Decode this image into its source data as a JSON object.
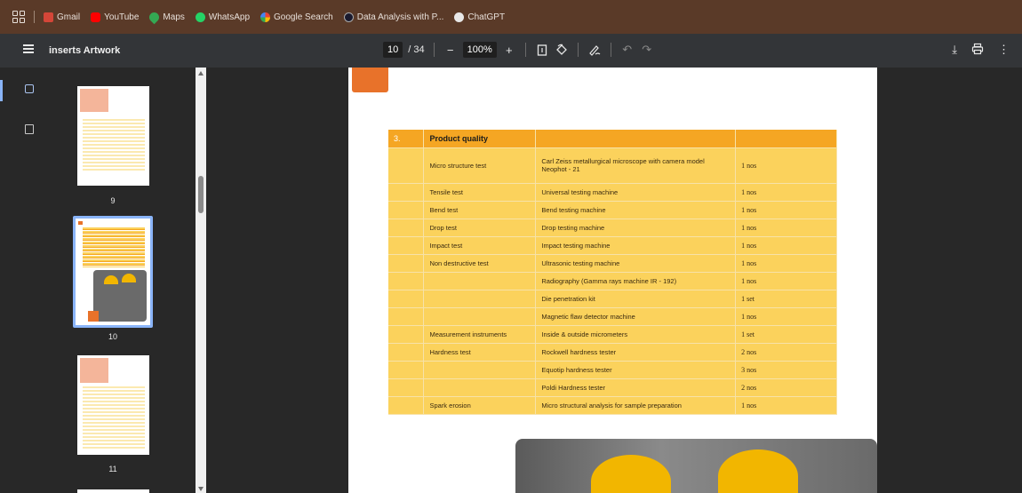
{
  "bookmarks": [
    {
      "label": "Gmail",
      "icon": "gmail-icon",
      "color": "#d44638"
    },
    {
      "label": "YouTube",
      "icon": "youtube-icon",
      "color": "#ff0000"
    },
    {
      "label": "Maps",
      "icon": "maps-icon",
      "color": "#34a853"
    },
    {
      "label": "WhatsApp",
      "icon": "whatsapp-icon",
      "color": "#25d366"
    },
    {
      "label": "Google Search",
      "icon": "google-icon",
      "color": "#4285f4"
    },
    {
      "label": "Data Analysis with P...",
      "icon": "data-analysis-icon",
      "color": "#1a1a2e"
    },
    {
      "label": "ChatGPT",
      "icon": "chatgpt-icon",
      "color": "#e8e8e8"
    }
  ],
  "toolbar": {
    "title": "inserts Artwork",
    "page_current": "10",
    "page_total": "/ 34",
    "zoom": "100%",
    "zoom_out": "−",
    "zoom_in": "+"
  },
  "thumbnails": [
    {
      "label": "9"
    },
    {
      "label": "10"
    },
    {
      "label": "11"
    }
  ],
  "table": {
    "header": {
      "no": "3.",
      "title": "Product quality"
    },
    "rows": [
      {
        "test": "Micro structure test",
        "equipment": "Carl Zeiss metallurgical microscope with camera model Neophot - 21",
        "qty": "1 nos",
        "tall": true
      },
      {
        "test": "Tensile test",
        "equipment": "Universal testing machine",
        "qty": "1 nos"
      },
      {
        "test": "Bend test",
        "equipment": "Bend testing machine",
        "qty": "1 nos"
      },
      {
        "test": "Drop test",
        "equipment": "Drop testing machine",
        "qty": "1 nos"
      },
      {
        "test": "Impact test",
        "equipment": "Impact testing machine",
        "qty": "1 nos"
      },
      {
        "test": "Non destructive test",
        "equipment": "Ultrasonic testing machine",
        "qty": "1 nos"
      },
      {
        "test": "",
        "equipment": "Radiography (Gamma rays machine IR - 192)",
        "qty": "1 nos"
      },
      {
        "test": "",
        "equipment": "Die penetration kit",
        "qty": "1 set"
      },
      {
        "test": "",
        "equipment": "Magnetic flaw detector machine",
        "qty": "1 nos"
      },
      {
        "test": "Measurement instruments",
        "equipment": "Inside & outside micrometers",
        "qty": "1 set"
      },
      {
        "test": "Hardness test",
        "equipment": "Rockwell hardness tester",
        "qty": "2 nos"
      },
      {
        "test": "",
        "equipment": "Equotip hardness tester",
        "qty": "3 nos"
      },
      {
        "test": "",
        "equipment": "Poldi Hardness tester",
        "qty": "2 nos"
      },
      {
        "test": "Spark erosion",
        "equipment": "Micro structural analysis for sample preparation",
        "qty": "1 nos"
      }
    ]
  },
  "colors": {
    "header_orange": "#f5a623",
    "row_yellow": "#fbd25c",
    "accent_orange": "#e8722a",
    "selection_blue": "#8ab4f8"
  }
}
